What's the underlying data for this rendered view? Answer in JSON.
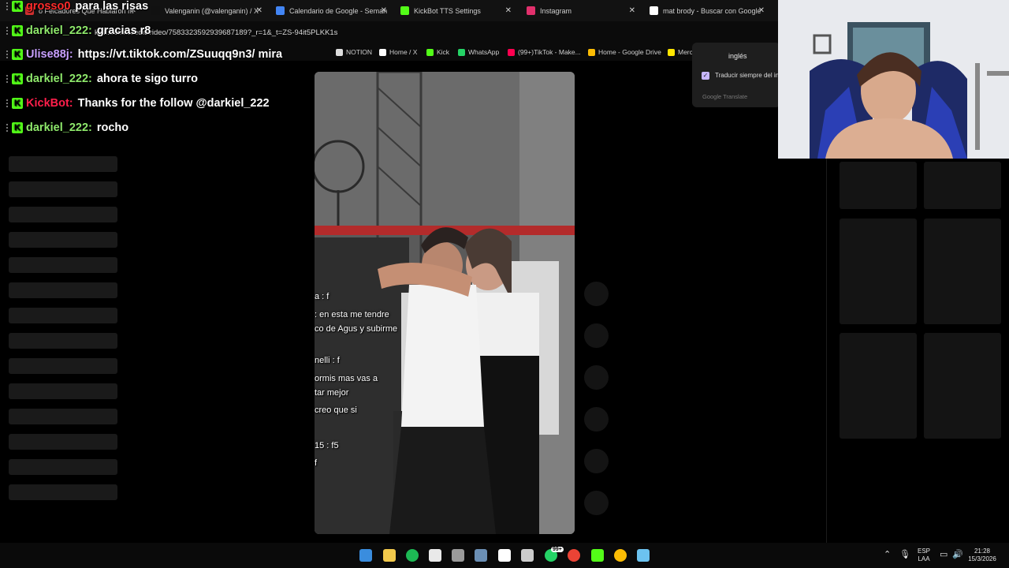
{
  "browser": {
    "tabs": [
      {
        "label": "o Felcadores Que Hablaron m",
        "fav_color": "#d03030",
        "has_close": true
      },
      {
        "label": "Valenganin (@valenganin) / X",
        "fav_color": "#111111",
        "has_close": true
      },
      {
        "label": "Calendario de Google - Seman",
        "fav_color": "#4285f4",
        "has_close": true
      },
      {
        "label": "KickBot TTS Settings",
        "fav_color": "#53fc18",
        "has_close": true
      },
      {
        "label": "Instagram",
        "fav_color": "#e1306c",
        "has_close": true
      },
      {
        "label": "mat brody - Buscar con Google",
        "fav_color": "#ffffff",
        "has_close": true
      }
    ],
    "url": "kick.com/.../edit/video/7583323592939687189?_r=1&_t=ZS-94it5PLKK1s",
    "bookmarks": [
      {
        "label": "NOTION",
        "icon_color": "#dddddd"
      },
      {
        "label": "Home / X",
        "icon_color": "#ffffff"
      },
      {
        "label": "Kick",
        "icon_color": "#53fc18"
      },
      {
        "label": "WhatsApp",
        "icon_color": "#25d366"
      },
      {
        "label": "(99+)TikTok - Make...",
        "icon_color": "#ff0050"
      },
      {
        "label": "Home - Google Drive",
        "icon_color": "#fbbc04"
      },
      {
        "label": "Merc",
        "icon_color": "#ffe600"
      }
    ],
    "close_glyph": "✕"
  },
  "chat": {
    "messages": [
      {
        "user": "grosso0",
        "user_color": "#ff2b2b",
        "text": "para las risas",
        "text_color": "#ffffff"
      },
      {
        "user": "darkiel_222:",
        "user_color": "#8ee86b",
        "text": "gracias r8",
        "text_color": "#ffffff"
      },
      {
        "user": "Ulise88j:",
        "user_color": "#c8a0ff",
        "text": "https://vt.tiktok.com/ZSuuqq9n3/ mira",
        "text_color": "#ffffff"
      },
      {
        "user": "darkiel_222:",
        "user_color": "#8ee86b",
        "text": "ahora te sigo turro",
        "text_color": "#ffffff"
      },
      {
        "user": "KickBot:",
        "user_color": "#ff1f4b",
        "text": "Thanks for the follow @darkiel_222",
        "text_color": "#ffffff"
      },
      {
        "user": "darkiel_222:",
        "user_color": "#8ee86b",
        "text": "rocho",
        "text_color": "#ffffff"
      }
    ],
    "badge_glyph": "K"
  },
  "video": {
    "comments": [
      {
        "text": "a : f"
      },
      {
        "text": ": en esta me tendre"
      },
      {
        "text": "co de Agus y subirme"
      },
      {
        "text": "nelli : f"
      },
      {
        "text": "ormis mas vas a"
      },
      {
        "text": "tar mejor"
      },
      {
        "text": "creo que si"
      },
      {
        "text": "15 : f5"
      },
      {
        "text": "f"
      }
    ]
  },
  "translate_popup": {
    "language": "inglés",
    "always_translate": "Traducir siempre del in",
    "always_checked": true,
    "brand": "Google Translate"
  },
  "taskbar": {
    "apps": [
      {
        "name": "windows-start-icon",
        "color": "#3a8dde"
      },
      {
        "name": "file-explorer-icon",
        "color": "#f2c94c"
      },
      {
        "name": "spotify-icon",
        "color": "#1db954"
      },
      {
        "name": "microsoft-store-icon",
        "color": "#e9e9e9"
      },
      {
        "name": "calculator-icon",
        "color": "#9a9a9a"
      },
      {
        "name": "steam-icon",
        "color": "#6b8fb5"
      },
      {
        "name": "capcut-icon",
        "color": "#ffffff"
      },
      {
        "name": "obs-icon",
        "color": "#cccccc"
      },
      {
        "name": "whatsapp-icon",
        "color": "#25d366"
      },
      {
        "name": "chrome-icon",
        "color": "#ea4335"
      },
      {
        "name": "kick-icon",
        "color": "#53fc18"
      },
      {
        "name": "chrome-alt-icon",
        "color": "#fbbc04"
      },
      {
        "name": "notepad-icon",
        "color": "#6cc3f0"
      }
    ],
    "whatsapp_badge": "99+",
    "lang_top": "ESP",
    "lang_bottom": "LAA",
    "time": "21:28",
    "date": "15/3/2026"
  }
}
